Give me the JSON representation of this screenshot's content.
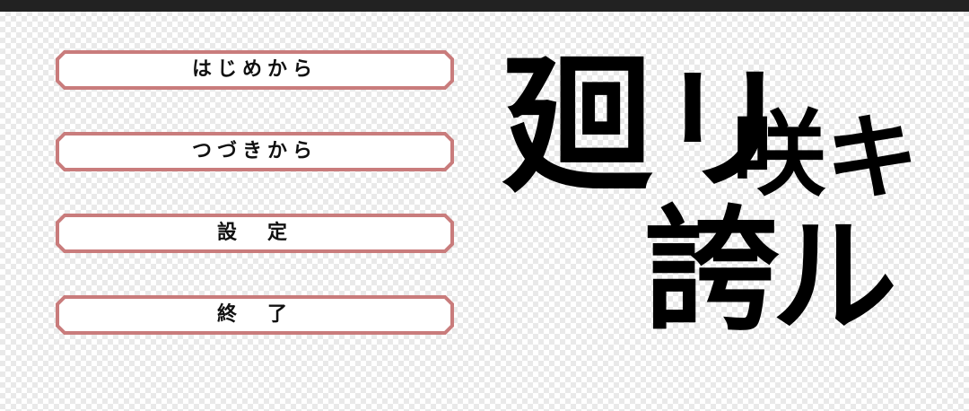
{
  "menu": {
    "border_color": "#c97c7c",
    "items": [
      {
        "label": "はじめから"
      },
      {
        "label": "つづきから"
      },
      {
        "label": "設　定"
      },
      {
        "label": "終　了"
      }
    ]
  },
  "logo": {
    "chars": [
      "廻",
      "リ",
      "咲",
      "キ",
      "誇",
      "ル"
    ]
  }
}
